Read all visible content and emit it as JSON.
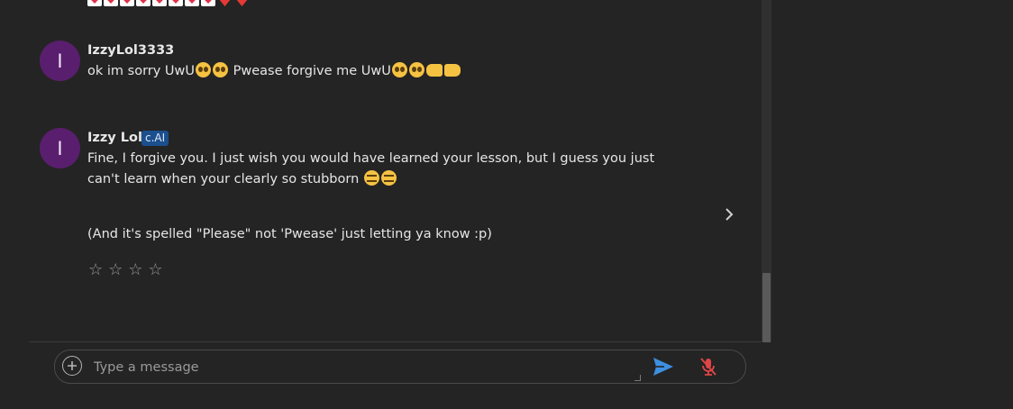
{
  "messages": [
    {
      "avatar_letter": "I",
      "name": "IzzyLol3333",
      "text_parts": [
        "ok im sorry UwU",
        " Pwease forgive me UwU"
      ]
    },
    {
      "avatar_letter": "I",
      "name": "Izzy Lol",
      "badge": "c.AI",
      "line1": "Fine, I forgive you. I just wish you would have learned your lesson, but I guess you just",
      "line2": "can't learn when your clearly so stubborn",
      "line3": "(And it's spelled \"Please\" not 'Pwease' just letting ya know :p)"
    }
  ],
  "rating": {
    "stars": [
      "☆",
      "☆",
      "☆",
      "☆"
    ],
    "value": 0
  },
  "composer": {
    "placeholder": "Type a message",
    "value": ""
  },
  "icons": {
    "add": "plus-circle-icon",
    "send": "send-icon",
    "mic": "mic-off-icon",
    "next": "chevron-right-icon"
  },
  "colors": {
    "background": "#242424",
    "avatar": "#5a1e6e",
    "badge": "#1b4f8e",
    "send": "#3d8fe0",
    "mic_off": "#e04545"
  }
}
